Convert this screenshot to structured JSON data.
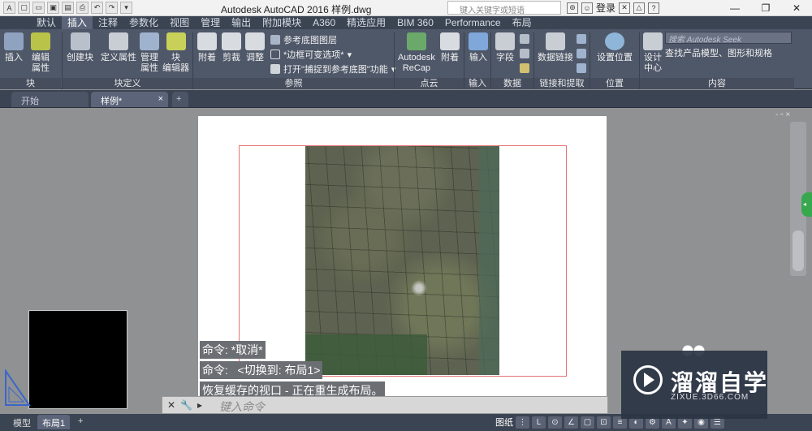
{
  "app_title": "Autodesk AutoCAD 2016    样例.dwg",
  "search": {
    "placeholder": "键入关键字或短语"
  },
  "login_label": "登录",
  "ribbon_tabs": [
    "默认",
    "插入",
    "注释",
    "参数化",
    "视图",
    "管理",
    "输出",
    "附加模块",
    "A360",
    "精选应用",
    "BIM 360",
    "Performance",
    "布局"
  ],
  "active_tab": "插入",
  "ribbon": {
    "block": {
      "header": "块",
      "insert": "插入",
      "edit_attr": "编辑\n属性"
    },
    "block_def": {
      "header": "块定义",
      "create": "创建块",
      "define_attr": "定义属性",
      "manage_attr": "管理\n属性",
      "block_editor": "块\n编辑器"
    },
    "reference": {
      "header": "参照",
      "attach": "附着",
      "clip": "剪裁",
      "adjust": "调整",
      "underlay_layers": "参考底图图层",
      "frame_var": "*边框可变选项*",
      "snap_underlay": "打开\"捕捉到参考底图\"功能"
    },
    "pointcloud": {
      "header": "点云",
      "recap": "Autodesk\nReCap",
      "attach": "附着"
    },
    "import": {
      "header": "输入",
      "import": "输入"
    },
    "data": {
      "header": "数据",
      "field": "字段"
    },
    "linking": {
      "header": "链接和提取",
      "data_link": "数据链接"
    },
    "location": {
      "header": "位置",
      "set_location": "设置位置"
    },
    "content": {
      "header": "内容",
      "design_center": "设计\n中心",
      "seek_placeholder": "搜索 Autodesk Seek",
      "seek_desc": "查找产品模型、图形和规格"
    }
  },
  "file_tabs": [
    {
      "label": "开始"
    },
    {
      "label": "样例*"
    }
  ],
  "command_log": [
    "命令: *取消*",
    "命令:   <切换到: 布局1>",
    "恢复缓存的视口 - 正在重生成布局。"
  ],
  "command_input_placeholder": "键入命令",
  "layout_tabs": [
    "模型",
    "布局1"
  ],
  "status_paper": "图纸",
  "watermark": {
    "text": "溜溜自学",
    "url": "ZIXUE.3D66.COM"
  },
  "colors": {
    "ribbon_bg": "#4f5869",
    "tabbar": "#3b4453",
    "canvas": "#909193",
    "viewport_border": "#e57373"
  }
}
